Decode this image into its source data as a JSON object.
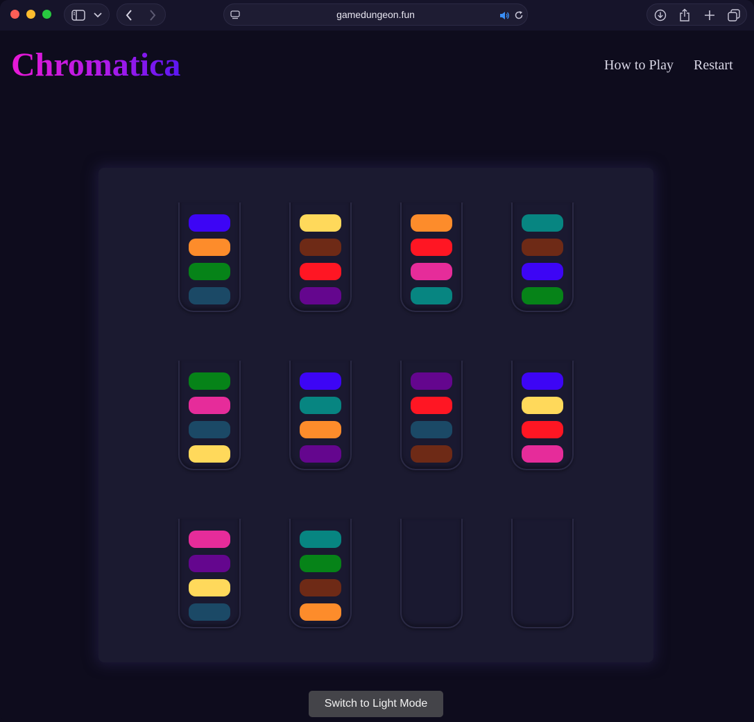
{
  "browser": {
    "url": "gamedungeon.fun"
  },
  "header": {
    "logo": "Chromatica",
    "nav": [
      {
        "label": "How to Play"
      },
      {
        "label": "Restart"
      }
    ]
  },
  "colors": {
    "blue": "#3d05f5",
    "orange": "#fd8c2b",
    "green": "#068318",
    "navy": "#1b4966",
    "yellow": "#ffd95b",
    "brown": "#6e2a16",
    "red": "#ff1623",
    "purple": "#64068e",
    "pink": "#e62c9a",
    "teal": "#078581"
  },
  "tubes": [
    [
      "blue",
      "orange",
      "green",
      "navy"
    ],
    [
      "yellow",
      "brown",
      "red",
      "purple"
    ],
    [
      "orange",
      "red",
      "pink",
      "teal"
    ],
    [
      "teal",
      "brown",
      "blue",
      "green"
    ],
    [
      "green",
      "pink",
      "navy",
      "yellow"
    ],
    [
      "blue",
      "teal",
      "orange",
      "purple"
    ],
    [
      "purple",
      "red",
      "navy",
      "brown"
    ],
    [
      "blue",
      "yellow",
      "red",
      "pink"
    ],
    [
      "pink",
      "purple",
      "yellow",
      "navy"
    ],
    [
      "teal",
      "green",
      "brown",
      "orange"
    ],
    [],
    []
  ],
  "footer": {
    "mode_button": "Switch to Light Mode"
  }
}
